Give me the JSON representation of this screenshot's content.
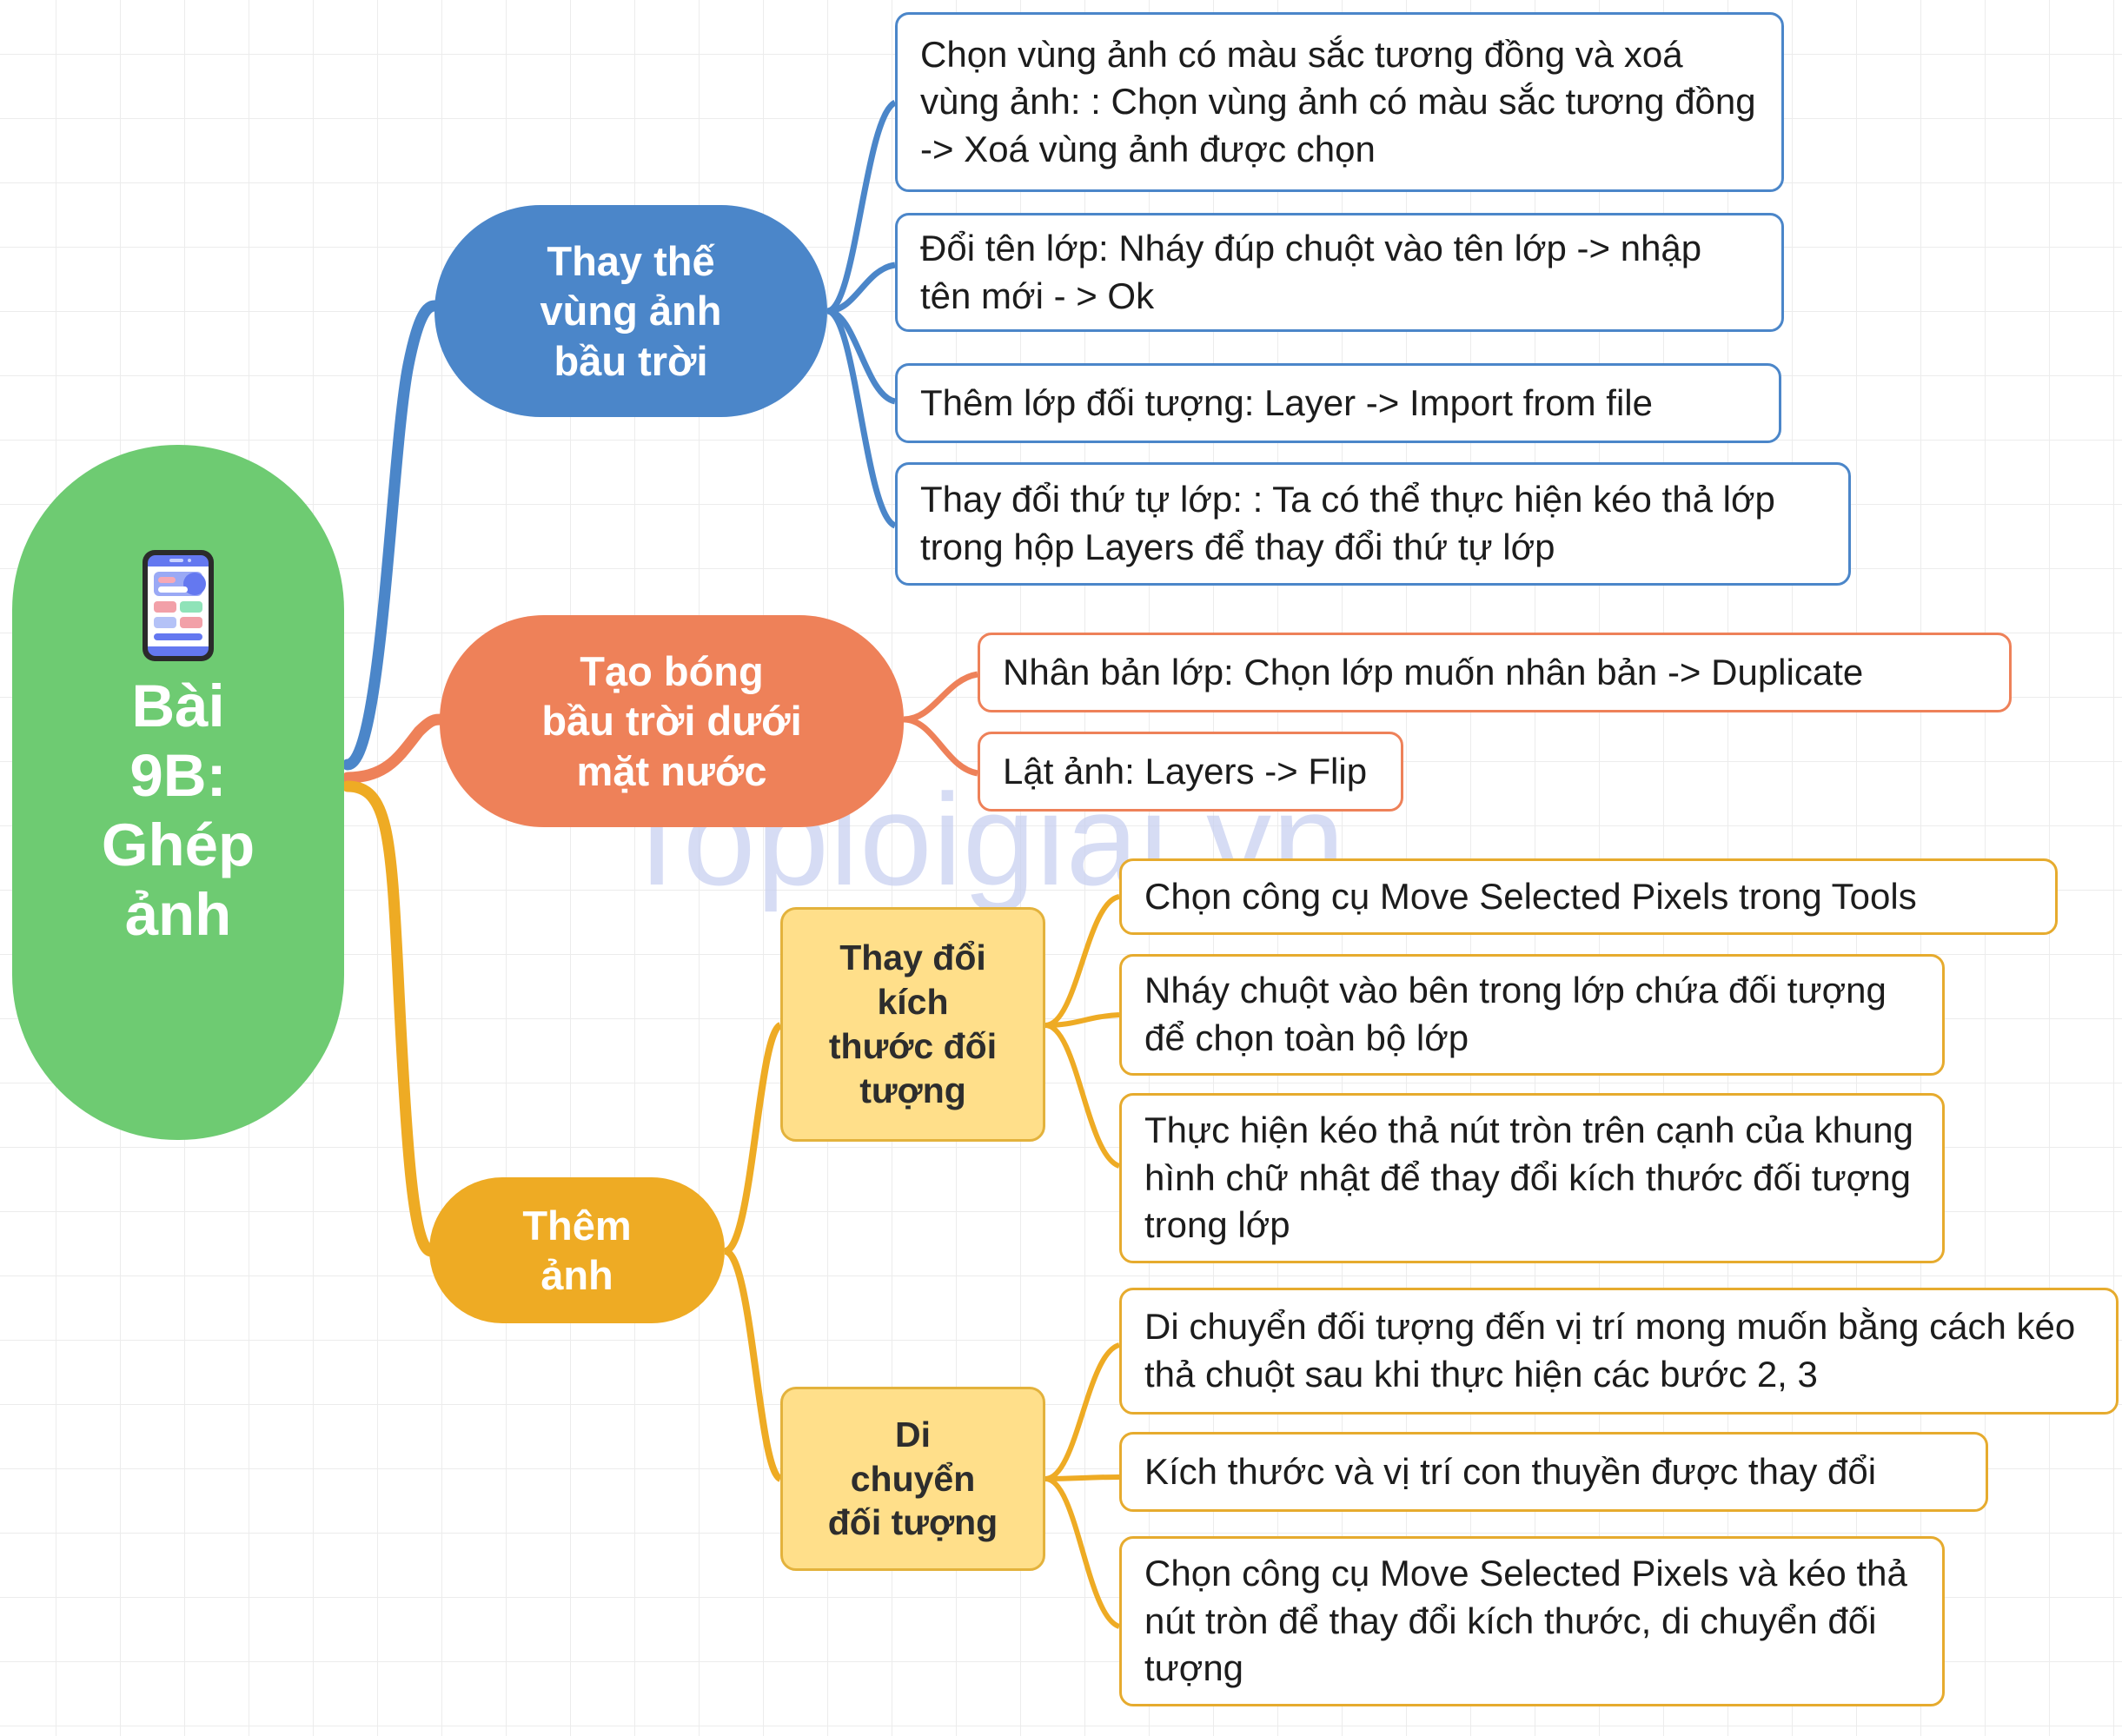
{
  "watermark": "Toploigiai.vn",
  "colors": {
    "root": "#6ecb72",
    "branch_blue": "#4b86c9",
    "branch_orange": "#ee8159",
    "branch_yellow": "#eeab24",
    "subnode_fill": "#ffdf8a",
    "subnode_border": "#e3b23c",
    "leaf_text": "#1c1c1c",
    "grid": "#ececec"
  },
  "root": {
    "label": "Bài\n9B:\nGhép\nảnh",
    "icon": "smartphone-app-icon"
  },
  "branches": [
    {
      "id": "thay-the-vung-anh-bau-troi",
      "label": "Thay thế\nvùng ảnh\nbầu trời",
      "color": "#4b86c9",
      "leaves": [
        "Chọn vùng ảnh có màu sắc tương đồng và xoá vùng ảnh: : Chọn vùng ảnh có màu sắc tương đồng -> Xoá vùng ảnh được chọn",
        "Đổi tên lớp: Nháy đúp chuột vào tên lớp -> nhập tên mới - > Ok",
        "Thêm lớp đối tượng: Layer -> Import from file",
        "Thay đổi thứ tự lớp: : Ta có thể thực hiện kéo thả lớp trong hộp Layers để thay đổi thứ tự lớp"
      ]
    },
    {
      "id": "tao-bong-bau-troi-duoi-mat-nuoc",
      "label": "Tạo bóng\nbầu trời dưới\nmặt nước",
      "color": "#ee8159",
      "leaves": [
        "Nhân bản lớp: Chọn lớp muốn nhân bản -> Duplicate",
        "Lật ảnh: Layers -> Flip"
      ]
    },
    {
      "id": "them-anh",
      "label": "Thêm\nảnh",
      "color": "#eeab24",
      "subnodes": [
        {
          "id": "thay-doi-kich-thuoc-doi-tuong",
          "label": "Thay đổi\nkích\nthước đối\ntượng",
          "leaves": [
            "Chọn công cụ Move Selected Pixels trong Tools",
            "Nháy chuột vào bên trong lớp chứa đối tượng để chọn toàn bộ lớp",
            "Thực hiện kéo thả nút tròn trên cạnh của khung hình chữ nhật để thay đổi kích thước đối tượng trong lớp"
          ]
        },
        {
          "id": "di-chuyen-doi-tuong",
          "label": "Di\nchuyển\nđối tượng",
          "leaves": [
            "Di chuyển đối tượng đến vị trí mong muốn bằng cách kéo thả chuột sau khi thực hiện các bước 2, 3",
            "Kích thước và vị trí con thuyền được thay đổi",
            "Chọn công cụ Move Selected Pixels và kéo thả nút tròn để thay đổi kích thước, di chuyển đối tượng"
          ]
        }
      ]
    }
  ]
}
